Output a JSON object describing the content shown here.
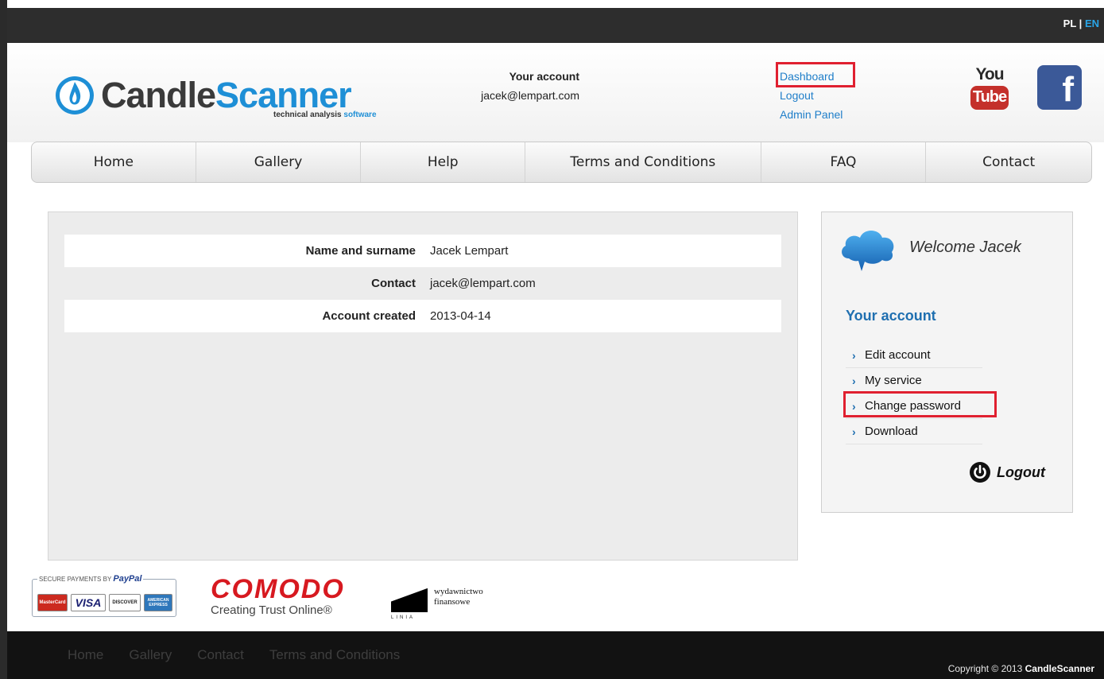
{
  "lang": {
    "pl": "PL",
    "sep": " | ",
    "en": "EN"
  },
  "logo": {
    "part1": "Candle",
    "part2": "Scanner",
    "sub1": "technical analysis ",
    "sub2": "software"
  },
  "account": {
    "label": "Your account",
    "email": "jacek@lempart.com",
    "links": [
      "Dashboard",
      "Logout",
      "Admin Panel"
    ]
  },
  "social": {
    "youtube_top": "You",
    "youtube_bottom": "Tube",
    "facebook": "f"
  },
  "nav": [
    "Home",
    "Gallery",
    "Help",
    "Terms and Conditions",
    "FAQ",
    "Contact"
  ],
  "profile": {
    "rows": [
      {
        "key": "Name and surname",
        "value": "Jacek Lempart"
      },
      {
        "key": "Contact",
        "value": "jacek@lempart.com"
      },
      {
        "key": "Account created",
        "value": "2013-04-14"
      }
    ]
  },
  "sidebar": {
    "welcome": "Welcome Jacek",
    "heading": "Your account",
    "items": [
      "Edit account",
      "My service",
      "Change password",
      "Download"
    ],
    "logout": "Logout"
  },
  "badges": {
    "paypal_title_prefix": "SECURE PAYMENTS BY ",
    "paypal_title_brand": "PayPal",
    "cards": [
      "MasterCard",
      "VISA",
      "DISCOVER",
      "AMERICAN EXPRESS"
    ],
    "comodo_logo": "COMODO",
    "comodo_tagline": "Creating Trust Online®",
    "linia_mark": "LINIA",
    "linia_line1": "wydawnictwo",
    "linia_line2": "finansowe"
  },
  "footer": {
    "links": [
      "Home",
      "Gallery",
      "Contact",
      "Terms and Conditions"
    ],
    "copyright_prefix": "Copyright © 2013 ",
    "copyright_brand": "CandleScanner"
  },
  "colors": {
    "accent": "#1f7ec9",
    "highlight": "#e02030",
    "topbar": "#2d2d2d",
    "footer": "#121212",
    "youtube": "#c4302b",
    "facebook": "#3b5998"
  },
  "icons": [
    "candle-flame-icon",
    "youtube-icon",
    "facebook-icon",
    "cloud-icon",
    "chevron-right-icon",
    "power-icon"
  ]
}
